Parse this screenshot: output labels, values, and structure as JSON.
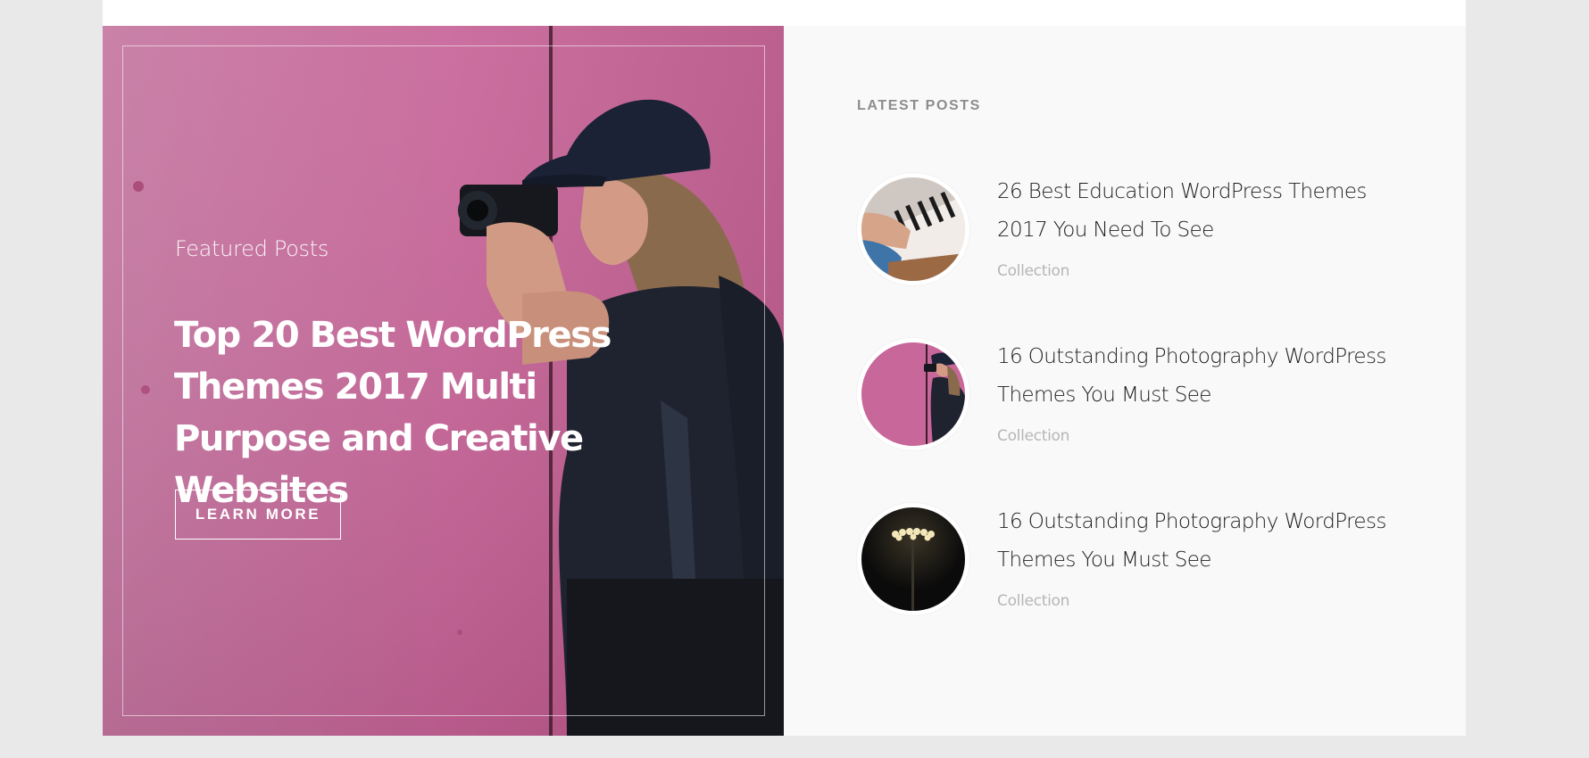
{
  "featured": {
    "kicker": "Featured Posts",
    "headline": "Top 20 Best WordPress Themes 2017 Multi Purpose and Creative Websites",
    "cta_label": "LEARN MORE",
    "background_color": "#c86a97"
  },
  "latest": {
    "section_title": "LATEST POSTS",
    "posts": [
      {
        "title": "26 Best Education WordPress Themes 2017 You Need To See",
        "category": "Collection",
        "thumb": "piano-photo"
      },
      {
        "title": "16 Outstanding Photography WordPress Themes You Must See",
        "category": "Collection",
        "thumb": "photographer-photo"
      },
      {
        "title": "16 Outstanding Photography WordPress Themes You Must See",
        "category": "Collection",
        "thumb": "streetlight-photo"
      }
    ]
  },
  "colors": {
    "page_bg": "#e9e9e9",
    "panel_bg": "#f9f9f9",
    "title_text": "#1d1d1d",
    "meta_text": "#b6b6b6",
    "section_title_text": "#8d8d8d"
  }
}
